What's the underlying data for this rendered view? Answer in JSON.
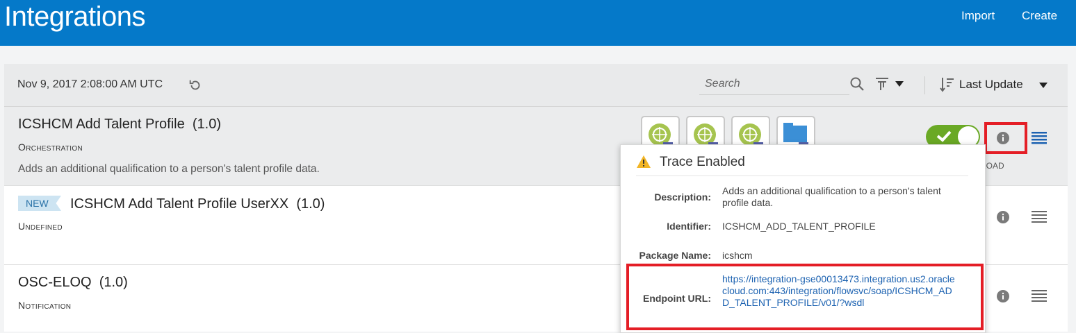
{
  "header": {
    "title": "Integrations",
    "import_label": "Import",
    "create_label": "Create"
  },
  "toolbar": {
    "timestamp": "Nov 9, 2017 2:08:00 AM UTC",
    "search_placeholder": "Search",
    "sort_label": "Last Update"
  },
  "integrations": [
    {
      "name": "ICSHCM Add Talent Profile",
      "version": "(1.0)",
      "type": "Orchestration",
      "description": "Adds an additional qualification to a person's talent profile data.",
      "status_fragment": "LOAD"
    },
    {
      "badge": "NEW",
      "name": "ICSHCM Add Talent Profile UserXX",
      "version": "(1.0)",
      "type": "Undefined"
    },
    {
      "name": "OSC-ELOQ",
      "version": "(1.0)",
      "type": "Notification"
    }
  ],
  "popup": {
    "title": "Trace Enabled",
    "description_label": "Description:",
    "description": "Adds an additional qualification to a person's talent profile data.",
    "identifier_label": "Identifier:",
    "identifier": "ICSHCM_ADD_TALENT_PROFILE",
    "package_label": "Package Name:",
    "package": "icshcm",
    "endpoint_label": "Endpoint URL:",
    "endpoint": "https://integration-gse00013473.integration.us2.oraclecloud.com:443/integration/flowsvc/soap/ICSHCM_ADD_TALENT_PROFILE/v01/?wsdl"
  },
  "colors": {
    "header": "#0579c9",
    "accent_link": "#1c62b1",
    "toggle_on": "#6aa925",
    "highlight": "#e41e26",
    "new_badge": "#cde4f2"
  },
  "icons": [
    "refresh-icon",
    "search-icon",
    "filter-icon",
    "sort-icon",
    "info-icon",
    "hamburger-menu-icon",
    "warning-icon",
    "adapter-icon"
  ]
}
